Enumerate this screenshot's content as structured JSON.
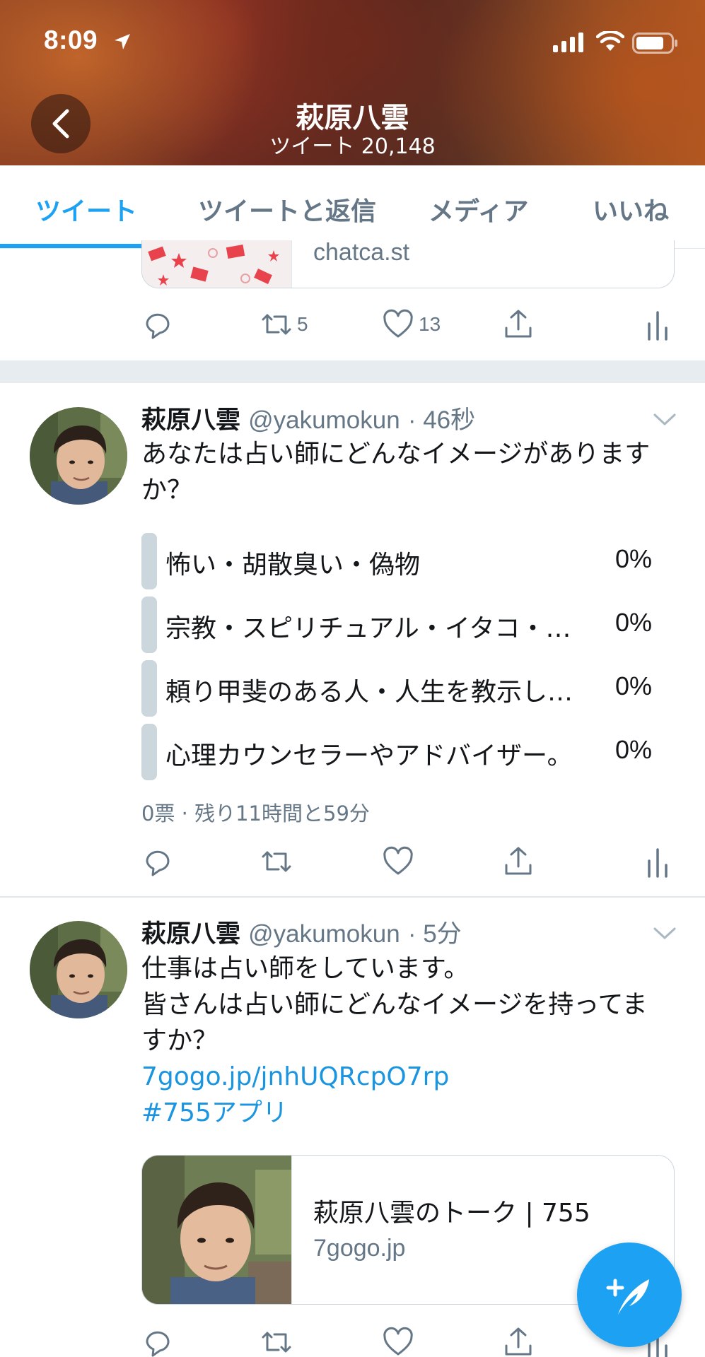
{
  "status_bar": {
    "time": "8:09"
  },
  "header": {
    "title": "萩原八雲",
    "subtitle": "ツイート 20,148"
  },
  "tabs": [
    {
      "label": "ツイート",
      "active": true
    },
    {
      "label": "ツイートと返信",
      "active": false
    },
    {
      "label": "メディア",
      "active": false
    },
    {
      "label": "いいね",
      "active": false
    }
  ],
  "tweet_prev": {
    "card_domain": "chatca.st",
    "retweets": "5",
    "likes": "13"
  },
  "tweet_poll": {
    "name": "萩原八雲",
    "handle": "@yakumokun",
    "time": "· 46秒",
    "text_line1": "あなたは占い師にどんなイメージがありま",
    "text_line2": "か？",
    "text_line1_end": "す",
    "options": [
      {
        "label": "怖い・胡散臭い・偽物",
        "percent": "0%"
      },
      {
        "label": "宗教・スピリチュアル・イタコ・…",
        "percent": "0%"
      },
      {
        "label": "頼り甲斐のある人・人生を教示し…",
        "percent": "0%"
      },
      {
        "label": "心理カウンセラーやアドバイザー。",
        "percent": "0%"
      }
    ],
    "meta": "0票 · 残り11時間と59分"
  },
  "tweet_link": {
    "name": "萩原八雲",
    "handle": "@yakumokun",
    "time": "· 5分",
    "line1": "仕事は占い師をしています。",
    "line2": "皆さんは占い師にどんなイメージを持ってま",
    "line3": "すか？",
    "link": "7gogo.jp/jnhUQRcpO7rp",
    "hashtag": "#755アプリ",
    "card_title": "萩原八雲のトーク | 755",
    "card_domain": "7gogo.jp"
  },
  "colors": {
    "accent": "#1da1f2",
    "secondary_text": "#657786",
    "poll_bar": "#ccd6dd"
  }
}
